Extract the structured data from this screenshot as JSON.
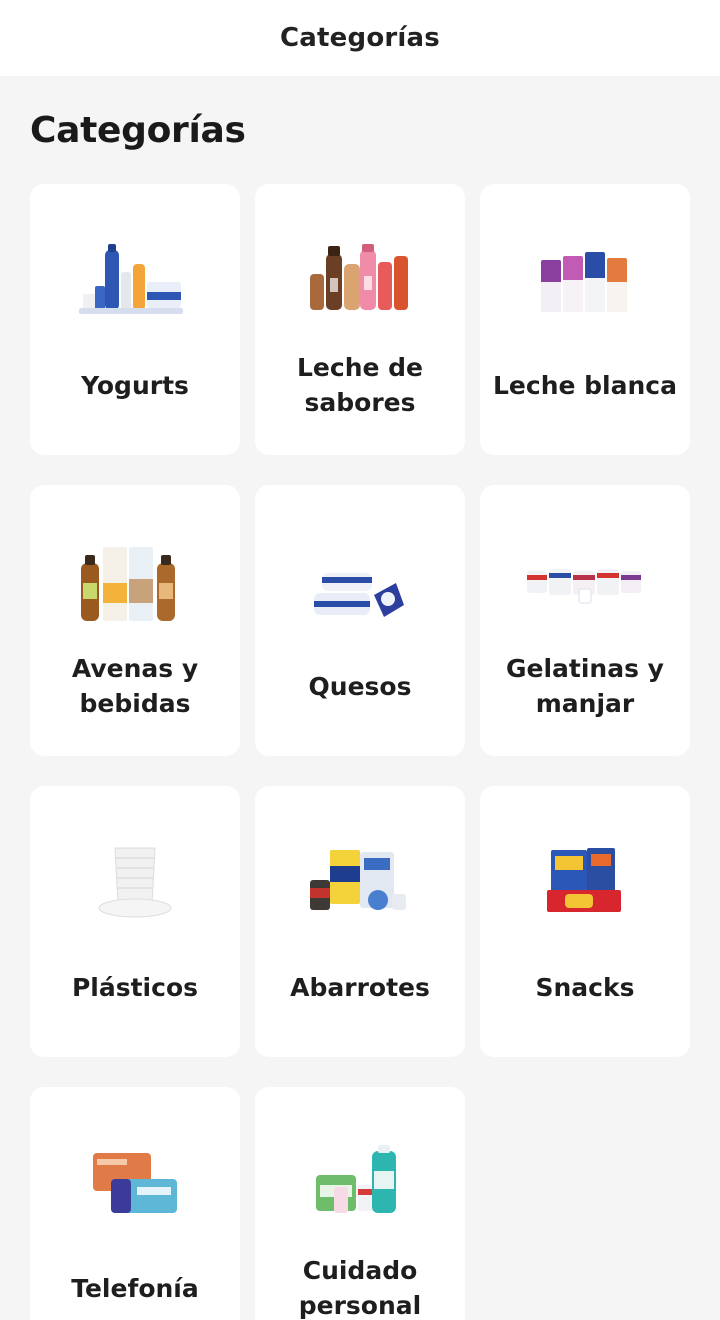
{
  "header": {
    "title": "Categorías"
  },
  "section": {
    "title": "Categorías"
  },
  "categories": [
    {
      "name": "Yogurts",
      "icon": "yogurt-products-image"
    },
    {
      "name": "Leche de sabores",
      "icon": "flavored-milk-products-image"
    },
    {
      "name": "Leche blanca",
      "icon": "white-milk-products-image"
    },
    {
      "name": "Avenas y bebidas",
      "icon": "oat-drinks-products-image"
    },
    {
      "name": "Quesos",
      "icon": "cheese-products-image"
    },
    {
      "name": "Gelatinas y manjar",
      "icon": "gelatin-products-image"
    },
    {
      "name": "Plásticos",
      "icon": "plastic-cups-image"
    },
    {
      "name": "Abarrotes",
      "icon": "grocery-products-image"
    },
    {
      "name": "Snacks",
      "icon": "snacks-products-image"
    },
    {
      "name": "Telefonía",
      "icon": "phone-cards-image"
    },
    {
      "name": "Cuidado personal",
      "icon": "personal-care-products-image"
    }
  ],
  "colors": {
    "background": "#f5f5f5",
    "card": "#ffffff",
    "text": "#1e1e1e"
  }
}
